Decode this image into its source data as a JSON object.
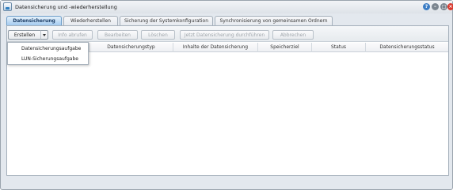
{
  "window": {
    "title": "Datensicherung und -wiederherstellung",
    "help_glyph": "?",
    "min_glyph": "–",
    "max_glyph": "□",
    "close_glyph": "×"
  },
  "tabs": [
    {
      "label": "Datensicherung",
      "active": true
    },
    {
      "label": "Wiederherstellen",
      "active": false
    },
    {
      "label": "Sicherung der Systemkonfiguration",
      "active": false
    },
    {
      "label": "Synchronisierung von gemeinsamen Ordnern",
      "active": false
    }
  ],
  "toolbar": {
    "create": "Erstellen",
    "info": "Info abrufen",
    "edit": "Bearbeiten",
    "delete": "Löschen",
    "backup_now": "Jetzt Datensicherung durchführen",
    "cancel": "Abbrechen"
  },
  "columns": [
    "Datensicherungstyp",
    "Inhalte der Datensicherung",
    "Speicherziel",
    "Status",
    "Datensicherungsstatus"
  ],
  "create_menu": [
    "Datensicherungsaufgabe",
    "LUN-Sicherungsaufgabe"
  ],
  "colors": {
    "active_tab": "#9cc7ef",
    "close_button": "#d9392e",
    "help_button": "#3a7cc4"
  }
}
